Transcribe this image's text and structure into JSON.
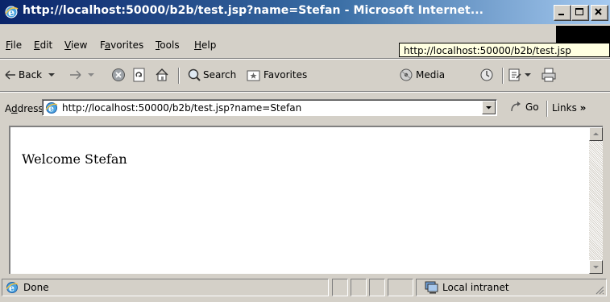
{
  "window": {
    "title": "http://localhost:50000/b2b/test.jsp?name=Stefan - Microsoft Internet...",
    "controls": [
      "minimize",
      "maximize",
      "close"
    ]
  },
  "menu": {
    "items": [
      {
        "label": "File",
        "key": "F",
        "rest": "ile"
      },
      {
        "label": "Edit",
        "key": "E",
        "rest": "dit"
      },
      {
        "label": "View",
        "key": "V",
        "rest": "iew"
      },
      {
        "label": "Favorites",
        "pre": "F",
        "key": "a",
        "rest": "vorites"
      },
      {
        "label": "Tools",
        "key": "T",
        "rest": "ools"
      },
      {
        "label": "Help",
        "key": "H",
        "rest": "elp"
      }
    ],
    "tooltip": "http://localhost:50000/b2b/test.jsp"
  },
  "toolbar": {
    "back_label": "Back",
    "search_label": "Search",
    "favorites_label": "Favorites",
    "media_label": "Media"
  },
  "address": {
    "label_pre": "A",
    "label_key": "d",
    "label_rest": "dress",
    "url": "http://localhost:50000/b2b/test.jsp?name=Stefan",
    "go_label": "Go",
    "links_label": "Links",
    "links_chevron": "»"
  },
  "page": {
    "welcome_text": "Welcome Stefan"
  },
  "status": {
    "text": "Done",
    "zone": "Local intranet"
  },
  "colors": {
    "titlebar_start": "#0a246a",
    "titlebar_end": "#a6caf0",
    "chrome": "#d4d0c8",
    "tooltip_bg": "#ffffe1"
  }
}
